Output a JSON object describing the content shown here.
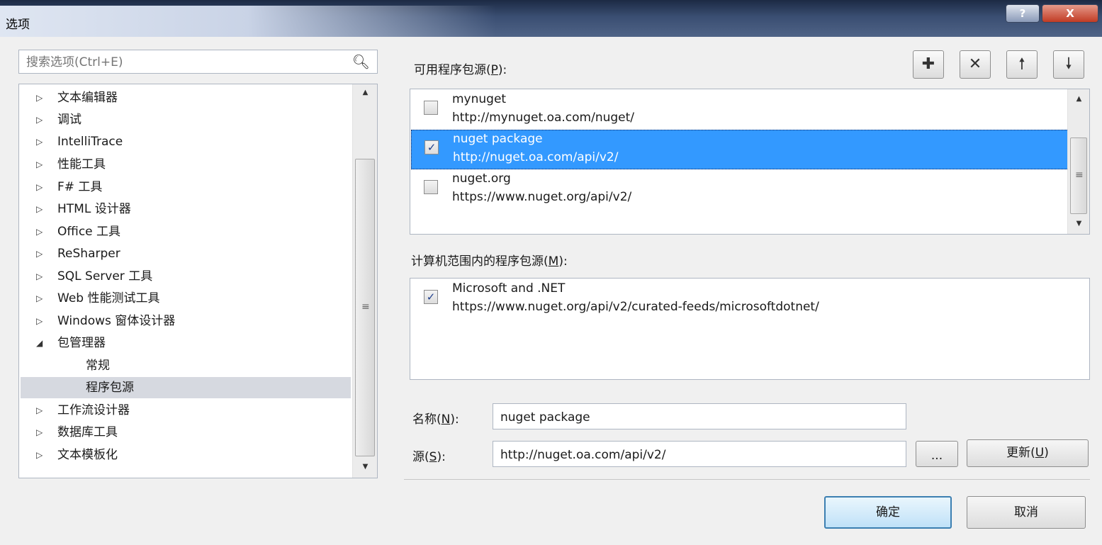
{
  "window": {
    "title": "选项",
    "help_glyph": "?",
    "close_glyph": "X"
  },
  "search": {
    "placeholder": "搜索选项(Ctrl+E)"
  },
  "tree": {
    "items": [
      {
        "label": "文本编辑器",
        "arrow": "▷"
      },
      {
        "label": "调试",
        "arrow": "▷"
      },
      {
        "label": "IntelliTrace",
        "arrow": "▷"
      },
      {
        "label": "性能工具",
        "arrow": "▷"
      },
      {
        "label": "F# 工具",
        "arrow": "▷"
      },
      {
        "label": "HTML 设计器",
        "arrow": "▷"
      },
      {
        "label": "Office 工具",
        "arrow": "▷"
      },
      {
        "label": "ReSharper",
        "arrow": "▷"
      },
      {
        "label": "SQL Server 工具",
        "arrow": "▷"
      },
      {
        "label": "Web 性能测试工具",
        "arrow": "▷"
      },
      {
        "label": "Windows 窗体设计器",
        "arrow": "▷"
      },
      {
        "label": "包管理器",
        "arrow": "◢"
      },
      {
        "label": "常规",
        "arrow": ""
      },
      {
        "label": "程序包源",
        "arrow": ""
      },
      {
        "label": "工作流设计器",
        "arrow": "▷"
      },
      {
        "label": "数据库工具",
        "arrow": "▷"
      },
      {
        "label": "文本模板化",
        "arrow": "▷"
      }
    ]
  },
  "available": {
    "label_prefix": "可用程序包源(",
    "label_key": "P",
    "label_suffix": "):",
    "sources": [
      {
        "name": "mynuget",
        "url": "http://mynuget.oa.com/nuget/",
        "checked": false
      },
      {
        "name": "nuget package",
        "url": "http://nuget.oa.com/api/v2/",
        "checked": true
      },
      {
        "name": "nuget.org",
        "url": "https://www.nuget.org/api/v2/",
        "checked": false
      }
    ]
  },
  "machine": {
    "label_prefix": "计算机范围内的程序包源(",
    "label_key": "M",
    "label_suffix": "):",
    "sources": [
      {
        "name": "Microsoft and .NET",
        "url": "https://www.nuget.org/api/v2/curated-feeds/microsoftdotnet/",
        "checked": true
      }
    ]
  },
  "form": {
    "name_label_prefix": "名称(",
    "name_key": "N",
    "name_label_suffix": "):",
    "name_value": "nuget package",
    "source_label_prefix": "源(",
    "source_key": "S",
    "source_label_suffix": "):",
    "source_value": "http://nuget.oa.com/api/v2/",
    "browse_label": "...",
    "update_label_prefix": "更新(",
    "update_key": "U",
    "update_label_suffix": ")"
  },
  "buttons": {
    "ok": "确定",
    "cancel": "取消"
  },
  "checkmark": "✓"
}
